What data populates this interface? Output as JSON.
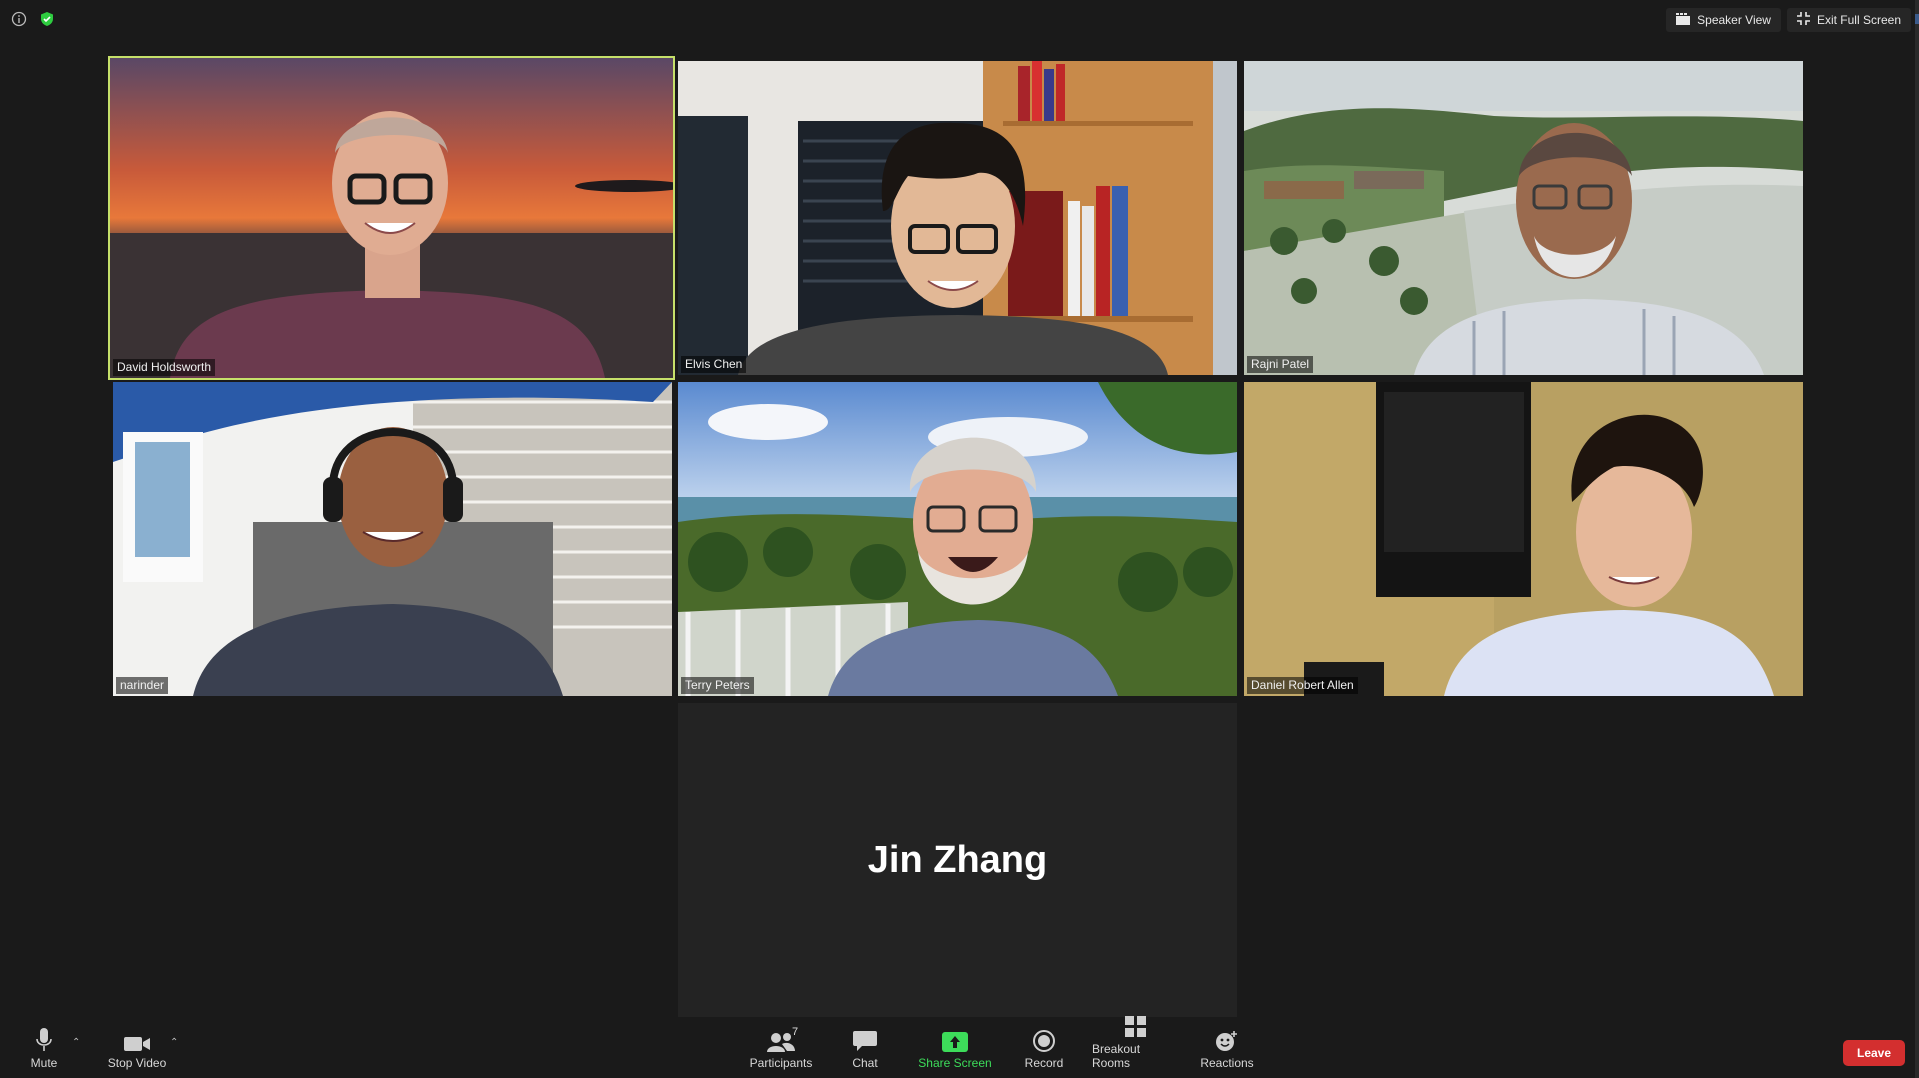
{
  "top_bar": {
    "speaker_view_label": "Speaker View",
    "exit_fullscreen_label": "Exit Full Screen"
  },
  "participants": [
    {
      "name": "David Holdsworth",
      "active_speaker": true
    },
    {
      "name": "Elvis Chen"
    },
    {
      "name": "Rajni Patel"
    },
    {
      "name": "narinder"
    },
    {
      "name": "Terry Peters"
    },
    {
      "name": "Daniel Robert Allen"
    },
    {
      "name": "Jin Zhang",
      "video_off": true
    }
  ],
  "toolbar": {
    "mute_label": "Mute",
    "stop_video_label": "Stop Video",
    "participants_label": "Participants",
    "participants_count": "7",
    "chat_label": "Chat",
    "share_screen_label": "Share Screen",
    "record_label": "Record",
    "breakout_rooms_label": "Breakout Rooms",
    "reactions_label": "Reactions",
    "leave_label": "Leave"
  },
  "colors": {
    "background": "#1a1a1a",
    "active_speaker_border": "#c6e06a",
    "share_screen_green": "#3ddc5a",
    "leave_red": "#d32f2f",
    "security_green": "#2ecc40"
  }
}
